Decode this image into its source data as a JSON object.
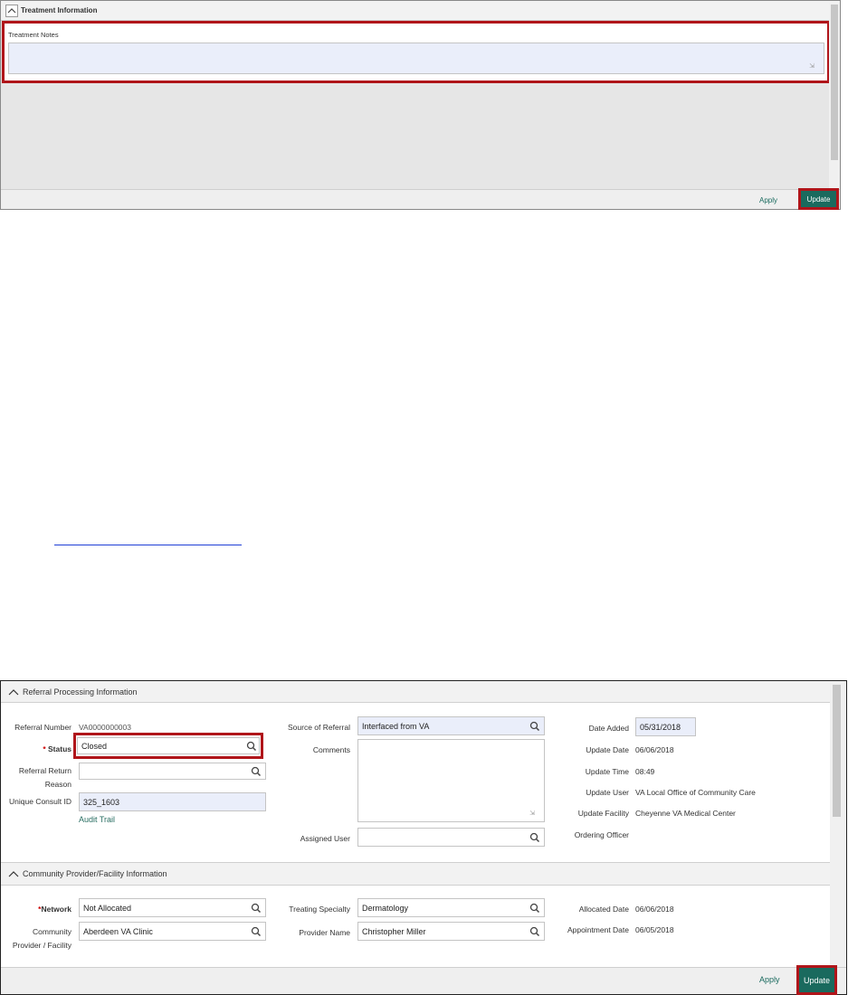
{
  "top": {
    "section_title": "Treatment Information",
    "notes_label": "Treatment Notes",
    "notes_value": "",
    "apply_label": "Apply",
    "update_label": "Update"
  },
  "bottom": {
    "referral_section_title": "Referral Processing Information",
    "referral_number_label": "Referral Number",
    "referral_number_value": "VA0000000003",
    "status_required": "*",
    "status_label": "Status",
    "status_value": "Closed",
    "return_reason_label_1": "Referral Return",
    "return_reason_label_2": "Reason",
    "return_reason_value": "",
    "consult_id_label": "Unique Consult ID",
    "consult_id_value": "325_1603",
    "audit_trail_label": "Audit Trail",
    "source_label": "Source of Referral",
    "source_value": "Interfaced from VA",
    "comments_label": "Comments",
    "comments_value": "",
    "assigned_user_label": "Assigned User",
    "assigned_user_value": "",
    "date_added_label": "Date Added",
    "date_added_value": "05/31/2018",
    "update_date_label": "Update Date",
    "update_date_value": "06/06/2018",
    "update_time_label": "Update Time",
    "update_time_value": "08:49",
    "update_user_label": "Update User",
    "update_user_value": "VA Local Office of Community Care",
    "update_facility_label": "Update Facility",
    "update_facility_value": "Cheyenne VA Medical Center",
    "ordering_officer_label": "Ordering Officer",
    "community_section_title": "Community Provider/Facility Information",
    "network_required": "*",
    "network_label": "Network",
    "network_value": "Not Allocated",
    "provider_facility_label_1": "Community",
    "provider_facility_label_2": "Provider / Facility",
    "provider_facility_value": "Aberdeen VA Clinic",
    "treating_specialty_label": "Treating Specialty",
    "treating_specialty_value": "Dermatology",
    "provider_name_label": "Provider Name",
    "provider_name_value": "Christopher Miller",
    "allocated_date_label": "Allocated Date",
    "allocated_date_value": "06/06/2018",
    "appointment_date_label": "Appointment Date",
    "appointment_date_value": "06/05/2018",
    "apply_label": "Apply",
    "update_label": "Update"
  },
  "colors": {
    "accent": "#1a6a5e",
    "highlight_box": "#b0151a",
    "link": "#1f3fd6",
    "input_fill": "#eaeefa"
  }
}
